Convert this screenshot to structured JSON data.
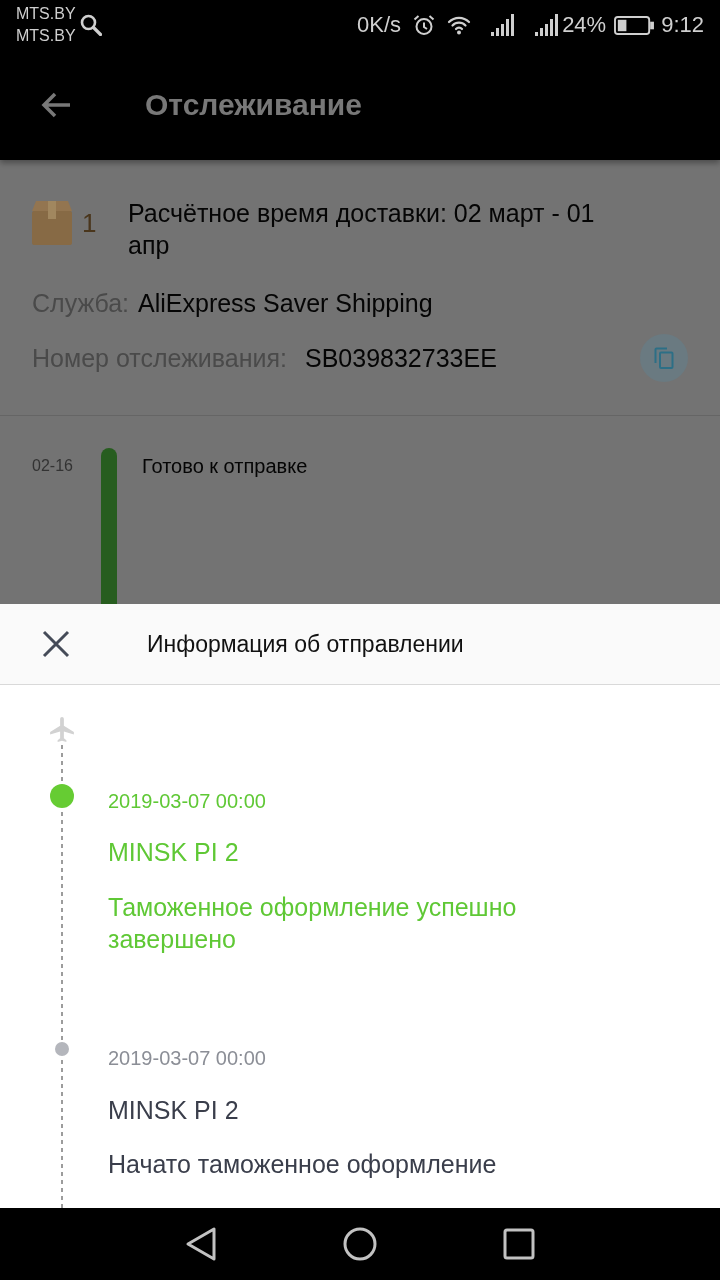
{
  "status_bar": {
    "carrier": [
      "MTS.BY",
      "MTS.BY"
    ],
    "network_speed": "0K/s",
    "battery": "24%",
    "time": "9:12"
  },
  "app_bar": {
    "title": "Отслеживание"
  },
  "shipment": {
    "package_count": "1",
    "delivery_estimate": "Расчётное время доставки: 02 март - 01 апр",
    "service": {
      "label": "Служба:",
      "value": "AliExpress Saver Shipping"
    },
    "tracking": {
      "label": "Номер отслеживания:",
      "value": "SB039832733EE"
    }
  },
  "tracking_steps": [
    {
      "date": "02-16",
      "status": "Готово к отправке"
    }
  ],
  "sheet": {
    "title": "Информация об отправлении",
    "events": [
      {
        "current": true,
        "date": "2019-03-07 00:00",
        "location": "MINSK PI 2",
        "description": "Таможенное оформление успешно завершено"
      },
      {
        "current": false,
        "date": "2019-03-07 00:00",
        "location": "MINSK PI 2",
        "description": "Начато таможенное оформление"
      }
    ]
  }
}
